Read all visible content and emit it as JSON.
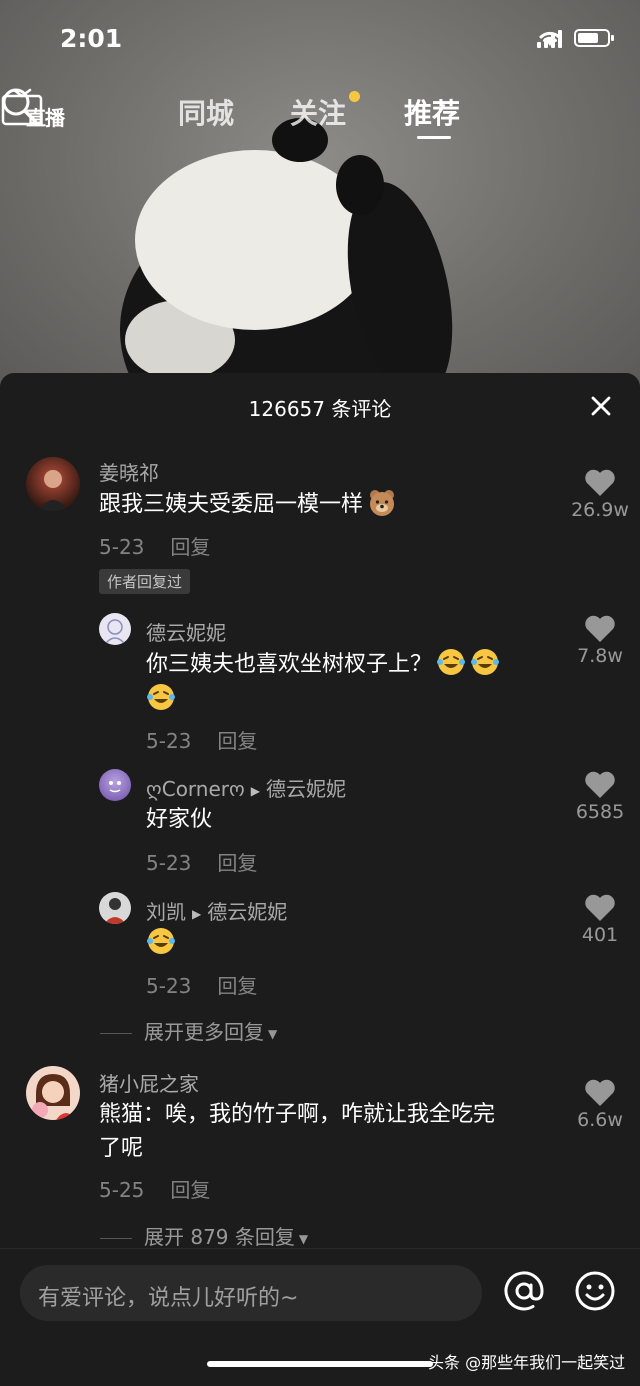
{
  "status_bar": {
    "time": "2:01"
  },
  "top_nav": {
    "live_label": "直播",
    "tabs": [
      {
        "label": "同城"
      },
      {
        "label": "关注"
      },
      {
        "label": "推荐"
      }
    ],
    "active_tab": "推荐"
  },
  "comments_sheet": {
    "count_label": "126657 条评论",
    "comments": [
      {
        "user": "姜晓祁",
        "text": "跟我三姨夫受委屈一模一样",
        "date": "5-23",
        "reply_label": "回复",
        "likes": "26.9w",
        "badge": "作者回复过",
        "replies": [
          {
            "user": "德云妮妮",
            "text": "你三姨夫也喜欢坐树杈子上？",
            "date": "5-23",
            "reply_label": "回复",
            "likes": "7.8w"
          },
          {
            "user": "ღCornerო",
            "reply_to": "德云妮妮",
            "text": "好家伙",
            "date": "5-23",
            "reply_label": "回复",
            "likes": "6585"
          },
          {
            "user": "刘凯",
            "reply_to": "德云妮妮",
            "text": "",
            "date": "5-23",
            "reply_label": "回复",
            "likes": "401"
          }
        ],
        "expand_label": "展开更多回复"
      },
      {
        "user": "猪小屁之家",
        "text_line1": "熊猫：唉，我的竹子啊，咋就让我全吃完",
        "text_line2": "了呢",
        "date": "5-25",
        "reply_label": "回复",
        "likes": "6.6w",
        "expand_label": "展开 879 条回复"
      }
    ]
  },
  "input_bar": {
    "placeholder": "有爱评论，说点儿好听的~"
  },
  "watermark": "头条 @那些年我们一起笑过",
  "colors": {
    "sheet_bg": "#1c1c1c",
    "accent_dot": "#f7c744",
    "emoji_yellow": "#f7c744"
  }
}
